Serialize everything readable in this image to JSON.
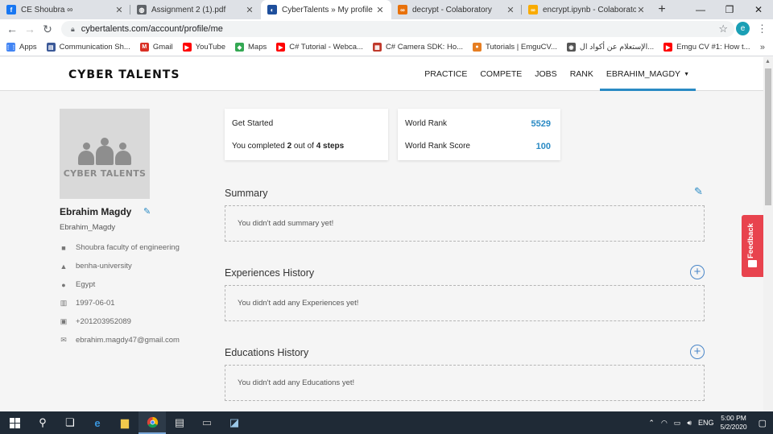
{
  "browser": {
    "tabs": [
      {
        "title": "CE Shoubra ∞",
        "favicon_color": "#1877f2",
        "favicon_glyph": "f",
        "active": false
      },
      {
        "title": "Assignment 2 (1).pdf",
        "favicon_color": "#5f6368",
        "favicon_glyph": "◍",
        "active": false
      },
      {
        "title": "CyberTalents » My profile",
        "favicon_color": "#1e4f9c",
        "favicon_glyph": "◐",
        "active": true
      },
      {
        "title": "decrypt - Colaboratory",
        "favicon_color": "#e8710a",
        "favicon_glyph": "∞",
        "active": false
      },
      {
        "title": "encrypt.ipynb - Colaboratory",
        "favicon_color": "#f9ab00",
        "favicon_glyph": "∞",
        "active": false
      }
    ],
    "new_tab": "+",
    "window_controls": {
      "minimize": "—",
      "restore": "❐",
      "close": "✕"
    },
    "url": "cybertalents.com/account/profile/me",
    "profile_initial": "e",
    "bookmarks": [
      {
        "label": "Apps",
        "icon": "apps-grid-icon",
        "color": "#4285f4",
        "glyph": "⋮⋮"
      },
      {
        "label": "Communication Sh...",
        "icon": "page-icon",
        "color": "#3b5998",
        "glyph": "▤"
      },
      {
        "label": "Gmail",
        "icon": "gmail-icon",
        "color": "#d93025",
        "glyph": "M"
      },
      {
        "label": "YouTube",
        "icon": "youtube-icon",
        "color": "#ff0000",
        "glyph": "▶"
      },
      {
        "label": "Maps",
        "icon": "maps-icon",
        "color": "#34a853",
        "glyph": "◆"
      },
      {
        "label": "C# Tutorial - Webca...",
        "icon": "youtube-icon",
        "color": "#ff0000",
        "glyph": "▶"
      },
      {
        "label": "C# Camera SDK: Ho...",
        "icon": "page-icon",
        "color": "#c0392b",
        "glyph": "▦"
      },
      {
        "label": "Tutorials | EmguCV...",
        "icon": "emgucv-icon",
        "color": "#e67e22",
        "glyph": "●"
      },
      {
        "label": "الإستعلام عن أكواد ال...",
        "icon": "globe-icon",
        "color": "#555555",
        "glyph": "◉"
      },
      {
        "label": "Emgu CV #1: How t...",
        "icon": "youtube-icon",
        "color": "#ff0000",
        "glyph": "▶"
      }
    ],
    "bookmarks_more": "»"
  },
  "site": {
    "logo": "CYBER TALENTS",
    "nav": [
      "PRACTICE",
      "COMPETE",
      "JOBS",
      "RANK"
    ],
    "user_menu": "EBRAHIM_MAGDY",
    "accent": "#2a8ac4"
  },
  "profile": {
    "avatar_brand": "CYBER TALENTS",
    "name": "Ebrahim Magdy",
    "username": "Ebrahim_Magdy",
    "details": [
      {
        "icon": "briefcase-icon",
        "glyph": "■",
        "text": "Shoubra faculty of engineering"
      },
      {
        "icon": "graduation-cap-icon",
        "glyph": "▲",
        "text": "benha-university"
      },
      {
        "icon": "map-marker-icon",
        "glyph": "●",
        "text": "Egypt"
      },
      {
        "icon": "birthday-cake-icon",
        "glyph": "▥",
        "text": "1997-06-01"
      },
      {
        "icon": "phone-icon",
        "glyph": "▣",
        "text": "+201203952089"
      },
      {
        "icon": "envelope-icon",
        "glyph": "✉",
        "text": "ebrahim.magdy47@gmail.com"
      }
    ]
  },
  "get_started": {
    "title": "Get Started",
    "progress_prefix": "You completed ",
    "completed": "2",
    "middle": " out of ",
    "total": "4 steps"
  },
  "rank": {
    "world_rank_label": "World Rank",
    "world_rank_value": "5529",
    "score_label": "World Rank Score",
    "score_value": "100"
  },
  "sections": {
    "summary": {
      "title": "Summary",
      "empty": "You didn't add summary yet!"
    },
    "experiences": {
      "title": "Experiences History",
      "empty": "You didn't add any Experiences yet!"
    },
    "educations": {
      "title": "Educations History",
      "empty": "You didn't add any Educations yet!"
    }
  },
  "feedback_label": "Feedback",
  "taskbar": {
    "time": "5:00 PM",
    "date": "5/2/2020",
    "language": "ENG"
  }
}
